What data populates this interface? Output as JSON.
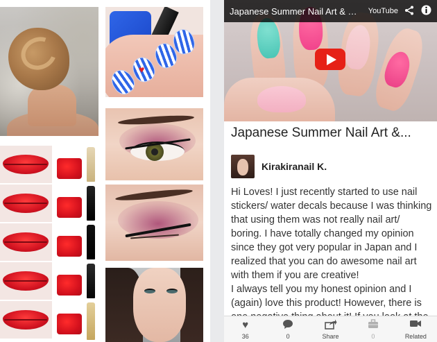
{
  "video": {
    "title": "Japanese Summer Nail Art & B...",
    "provider": "YouTube",
    "share_icon": "share-icon",
    "info_icon": "info-icon",
    "play_icon": "play-icon"
  },
  "detail": {
    "title": "Japanese Summer Nail Art &...",
    "author": "Kirakiranail K.",
    "description": [
      "Hi Loves! I just recently started to use nail stickers/ water decals because I was thinking that using them was not really nail art/ boring. I have totally changed my opinion since they got very popular in Japan and I realized that you can do awesome nail art with them if you are creative!",
      "I always tell you my honest opinion and I (again) love this product! However, there is one negative thing about it! If you look at the"
    ]
  },
  "tabs": [
    {
      "icon": "heart-icon",
      "glyph": "♥",
      "label": "36"
    },
    {
      "icon": "comment-icon",
      "glyph": "💬",
      "label": "0"
    },
    {
      "icon": "share-icon",
      "glyph": "⇪",
      "label": "Share"
    },
    {
      "icon": "briefcase-icon",
      "glyph": "💼",
      "label": "0"
    },
    {
      "icon": "video-camera-icon",
      "glyph": "🎥",
      "label": "Related"
    }
  ],
  "colors": {
    "accent_red": "#e62117",
    "header_bg": "#000000",
    "tabbar_bg": "#f6f6f6"
  }
}
